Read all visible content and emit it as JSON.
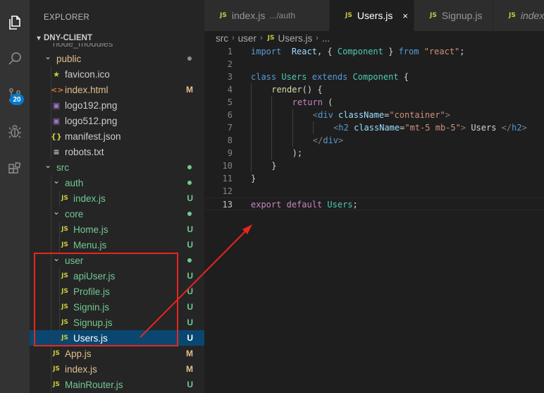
{
  "explorer": {
    "title": "EXPLORER",
    "section_title": "DNY-CLIENT",
    "cut_off_item": "node_modules"
  },
  "activity_bar": {
    "items": [
      {
        "icon": "files-icon"
      },
      {
        "icon": "search-icon"
      },
      {
        "icon": "source-control-icon",
        "badge": "20"
      },
      {
        "icon": "debug-icon"
      },
      {
        "icon": "extensions-icon"
      }
    ]
  },
  "tree": [
    {
      "label": "public",
      "type": "folder",
      "depth": 0,
      "open": true,
      "color": "#e2c08d",
      "status": "dot",
      "status_color": "#8d8d8d"
    },
    {
      "label": "favicon.ico",
      "type": "file",
      "depth": 1,
      "icon": "star-icon",
      "icon_glyph": "★",
      "icon_color": "#cbcb41",
      "color": "#cccccc"
    },
    {
      "label": "index.html",
      "type": "file",
      "depth": 1,
      "icon": "html-icon",
      "icon_glyph": "<>",
      "icon_color": "#e37933",
      "color": "#e2c08d",
      "status": "M",
      "status_color": "#e2c08d"
    },
    {
      "label": "logo192.png",
      "type": "file",
      "depth": 1,
      "icon": "image-icon",
      "icon_glyph": "▣",
      "icon_color": "#a074c4",
      "color": "#cccccc"
    },
    {
      "label": "logo512.png",
      "type": "file",
      "depth": 1,
      "icon": "image-icon",
      "icon_glyph": "▣",
      "icon_color": "#a074c4",
      "color": "#cccccc"
    },
    {
      "label": "manifest.json",
      "type": "file",
      "depth": 1,
      "icon": "json-icon",
      "icon_glyph": "{}",
      "icon_color": "#cbcb41",
      "color": "#cccccc"
    },
    {
      "label": "robots.txt",
      "type": "file",
      "depth": 1,
      "icon": "text-file-icon",
      "icon_glyph": "≡",
      "icon_color": "#cccccc",
      "color": "#cccccc"
    },
    {
      "label": "src",
      "type": "folder",
      "depth": 0,
      "open": true,
      "color": "#73c991",
      "status": "dot",
      "status_color": "#73c991"
    },
    {
      "label": "auth",
      "type": "folder",
      "depth": 1,
      "open": true,
      "color": "#73c991",
      "status": "dot",
      "status_color": "#73c991"
    },
    {
      "label": "index.js",
      "type": "file",
      "depth": 2,
      "icon": "js-icon",
      "icon_glyph": "JS",
      "icon_color": "#cbcb41",
      "color": "#73c991",
      "status": "U",
      "status_color": "#73c991"
    },
    {
      "label": "core",
      "type": "folder",
      "depth": 1,
      "open": true,
      "color": "#73c991",
      "status": "dot",
      "status_color": "#73c991"
    },
    {
      "label": "Home.js",
      "type": "file",
      "depth": 2,
      "icon": "js-icon",
      "icon_glyph": "JS",
      "icon_color": "#cbcb41",
      "color": "#73c991",
      "status": "U",
      "status_color": "#73c991"
    },
    {
      "label": "Menu.js",
      "type": "file",
      "depth": 2,
      "icon": "js-icon",
      "icon_glyph": "JS",
      "icon_color": "#cbcb41",
      "color": "#73c991",
      "status": "U",
      "status_color": "#73c991"
    },
    {
      "label": "user",
      "type": "folder",
      "depth": 1,
      "open": true,
      "color": "#73c991",
      "status": "dot",
      "status_color": "#73c991"
    },
    {
      "label": "apiUser.js",
      "type": "file",
      "depth": 2,
      "icon": "js-icon",
      "icon_glyph": "JS",
      "icon_color": "#cbcb41",
      "color": "#73c991",
      "status": "U",
      "status_color": "#73c991"
    },
    {
      "label": "Profile.js",
      "type": "file",
      "depth": 2,
      "icon": "js-icon",
      "icon_glyph": "JS",
      "icon_color": "#cbcb41",
      "color": "#73c991",
      "status": "U",
      "status_color": "#73c991"
    },
    {
      "label": "Signin.js",
      "type": "file",
      "depth": 2,
      "icon": "js-icon",
      "icon_glyph": "JS",
      "icon_color": "#cbcb41",
      "color": "#73c991",
      "status": "U",
      "status_color": "#73c991"
    },
    {
      "label": "Signup.js",
      "type": "file",
      "depth": 2,
      "icon": "js-icon",
      "icon_glyph": "JS",
      "icon_color": "#cbcb41",
      "color": "#73c991",
      "status": "U",
      "status_color": "#73c991"
    },
    {
      "label": "Users.js",
      "type": "file",
      "depth": 2,
      "icon": "js-icon",
      "icon_glyph": "JS",
      "icon_color": "#cbcb41",
      "color": "#ffffff",
      "status": "U",
      "status_color": "#ffffff",
      "selected": true
    },
    {
      "label": "App.js",
      "type": "file",
      "depth": 1,
      "icon": "js-icon",
      "icon_glyph": "JS",
      "icon_color": "#cbcb41",
      "color": "#e2c08d",
      "status": "M",
      "status_color": "#e2c08d"
    },
    {
      "label": "index.js",
      "type": "file",
      "depth": 1,
      "icon": "js-icon",
      "icon_glyph": "JS",
      "icon_color": "#cbcb41",
      "color": "#e2c08d",
      "status": "M",
      "status_color": "#e2c08d"
    },
    {
      "label": "MainRouter.js",
      "type": "file",
      "depth": 1,
      "icon": "js-icon",
      "icon_glyph": "JS",
      "icon_color": "#cbcb41",
      "color": "#73c991",
      "status": "U",
      "status_color": "#73c991"
    }
  ],
  "tabs": [
    {
      "name": "index.js",
      "desc": ".../auth",
      "active": false,
      "italic": false,
      "close": ""
    },
    {
      "name": "Users.js",
      "desc": "",
      "active": true,
      "italic": false,
      "close": "×"
    },
    {
      "name": "Signup.js",
      "desc": "",
      "active": false,
      "italic": false,
      "close": ""
    },
    {
      "name": "index",
      "desc": "",
      "active": false,
      "italic": true,
      "close": ""
    }
  ],
  "breadcrumb": {
    "parts": [
      "src",
      "user"
    ],
    "file": "Users.js",
    "tail": "..."
  },
  "editor": {
    "current_line": 13,
    "lines": [
      {
        "n": "1",
        "indent": 0,
        "tokens": [
          [
            "kw",
            "import"
          ],
          [
            "",
            "  "
          ],
          [
            "id",
            "React"
          ],
          [
            "",
            ", { "
          ],
          [
            "cls",
            "Component"
          ],
          [
            "",
            " } "
          ],
          [
            "kw",
            "from"
          ],
          [
            "",
            " "
          ],
          [
            "str",
            "\"react\""
          ],
          [
            "",
            ";"
          ]
        ]
      },
      {
        "n": "2",
        "indent": 0,
        "tokens": []
      },
      {
        "n": "3",
        "indent": 0,
        "tokens": [
          [
            "kw",
            "class"
          ],
          [
            "",
            " "
          ],
          [
            "cls",
            "Users"
          ],
          [
            "",
            " "
          ],
          [
            "kw",
            "extends"
          ],
          [
            "",
            " "
          ],
          [
            "cls",
            "Component"
          ],
          [
            "",
            " {"
          ]
        ]
      },
      {
        "n": "4",
        "indent": 1,
        "tokens": [
          [
            "fn",
            "render"
          ],
          [
            "",
            "() {"
          ]
        ]
      },
      {
        "n": "5",
        "indent": 2,
        "tokens": [
          [
            "kc",
            "return"
          ],
          [
            "",
            " ("
          ]
        ]
      },
      {
        "n": "6",
        "indent": 3,
        "tokens": [
          [
            "br",
            "<"
          ],
          [
            "tag",
            "div"
          ],
          [
            "",
            " "
          ],
          [
            "attr",
            "className"
          ],
          [
            "",
            "="
          ],
          [
            "str",
            "\"container\""
          ],
          [
            "br",
            ">"
          ]
        ]
      },
      {
        "n": "7",
        "indent": 4,
        "tokens": [
          [
            "br",
            "<"
          ],
          [
            "tag",
            "h2"
          ],
          [
            "",
            " "
          ],
          [
            "attr",
            "className"
          ],
          [
            "",
            "="
          ],
          [
            "str",
            "\"mt-5 mb-5\""
          ],
          [
            "br",
            ">"
          ],
          [
            "",
            " Users "
          ],
          [
            "br",
            "</"
          ],
          [
            "tag",
            "h2"
          ],
          [
            "br",
            ">"
          ]
        ]
      },
      {
        "n": "8",
        "indent": 3,
        "tokens": [
          [
            "br",
            "</"
          ],
          [
            "tag",
            "div"
          ],
          [
            "br",
            ">"
          ]
        ]
      },
      {
        "n": "9",
        "indent": 2,
        "tokens": [
          [
            "",
            ");"
          ]
        ]
      },
      {
        "n": "10",
        "indent": 1,
        "tokens": [
          [
            "",
            "}"
          ]
        ]
      },
      {
        "n": "11",
        "indent": 0,
        "tokens": [
          [
            "",
            "}"
          ]
        ]
      },
      {
        "n": "12",
        "indent": 0,
        "tokens": []
      },
      {
        "n": "13",
        "indent": 0,
        "tokens": [
          [
            "kc",
            "export"
          ],
          [
            "",
            " "
          ],
          [
            "kc",
            "default"
          ],
          [
            "",
            " "
          ],
          [
            "cls",
            "Users"
          ],
          [
            "",
            ";"
          ]
        ]
      }
    ]
  },
  "colors": {
    "accent": "#007acc",
    "selection": "#094771",
    "untracked": "#73c991",
    "modified": "#e2c08d",
    "annotation": "#e8261d"
  }
}
